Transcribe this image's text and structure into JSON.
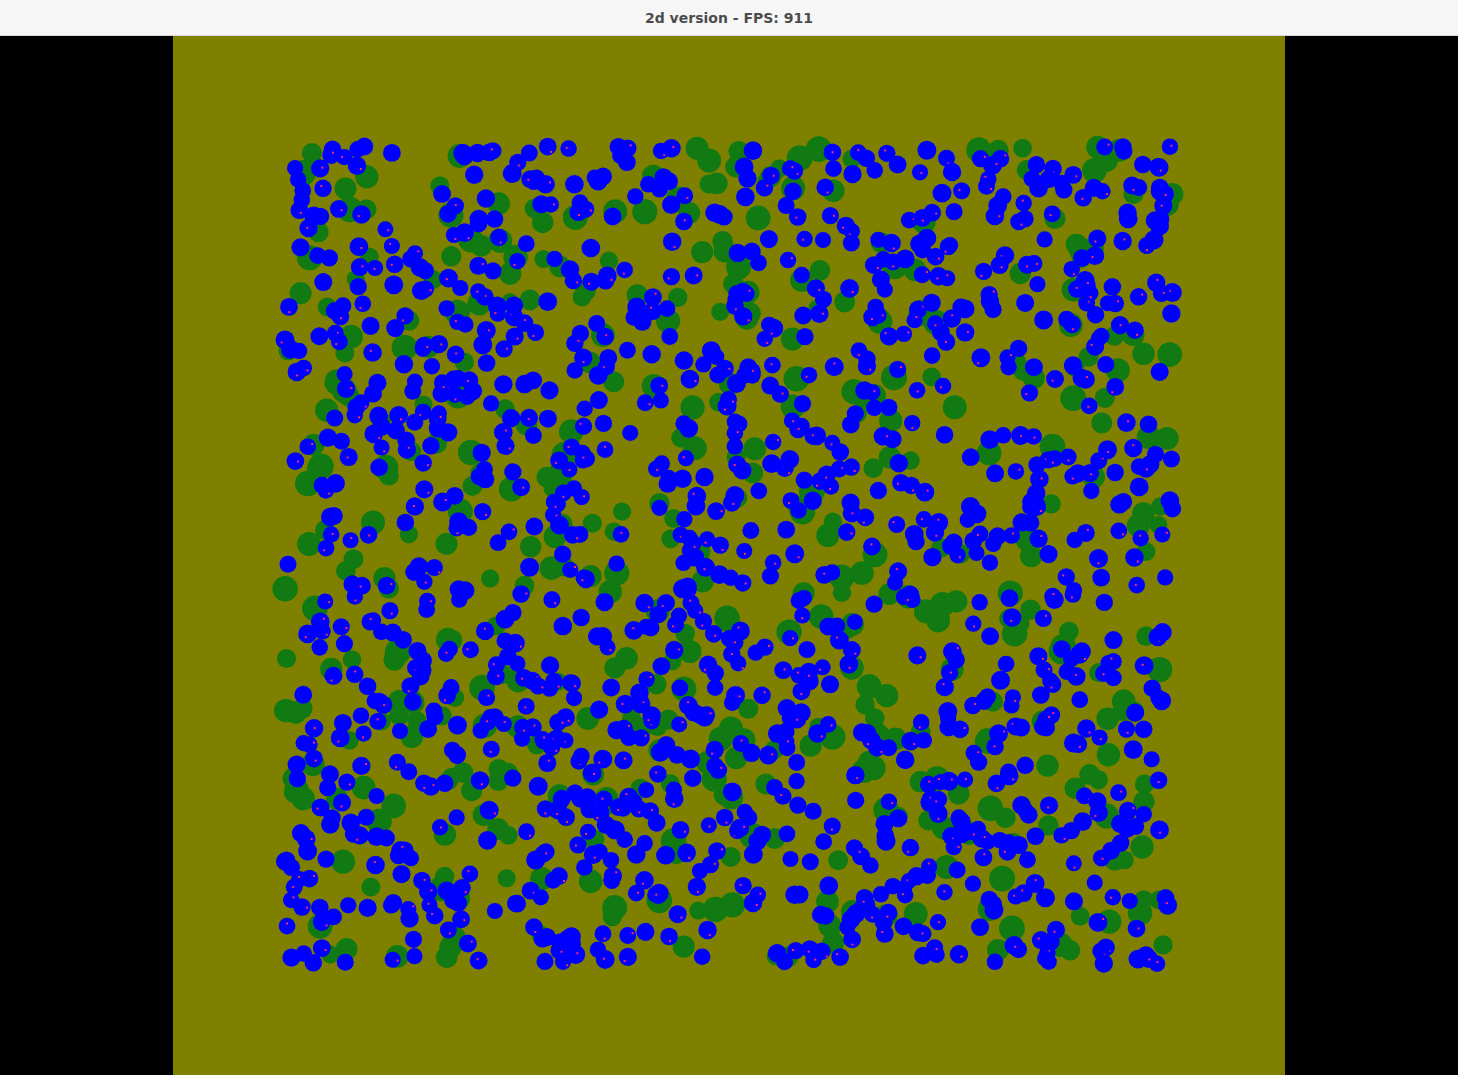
{
  "window": {
    "title": "2d version - FPS: 911"
  },
  "world": {
    "populations": [
      {
        "kind": "plant",
        "color": "#127a12",
        "count": 430
      },
      {
        "kind": "agent",
        "color": "#0000ff",
        "count": 1250
      }
    ]
  }
}
